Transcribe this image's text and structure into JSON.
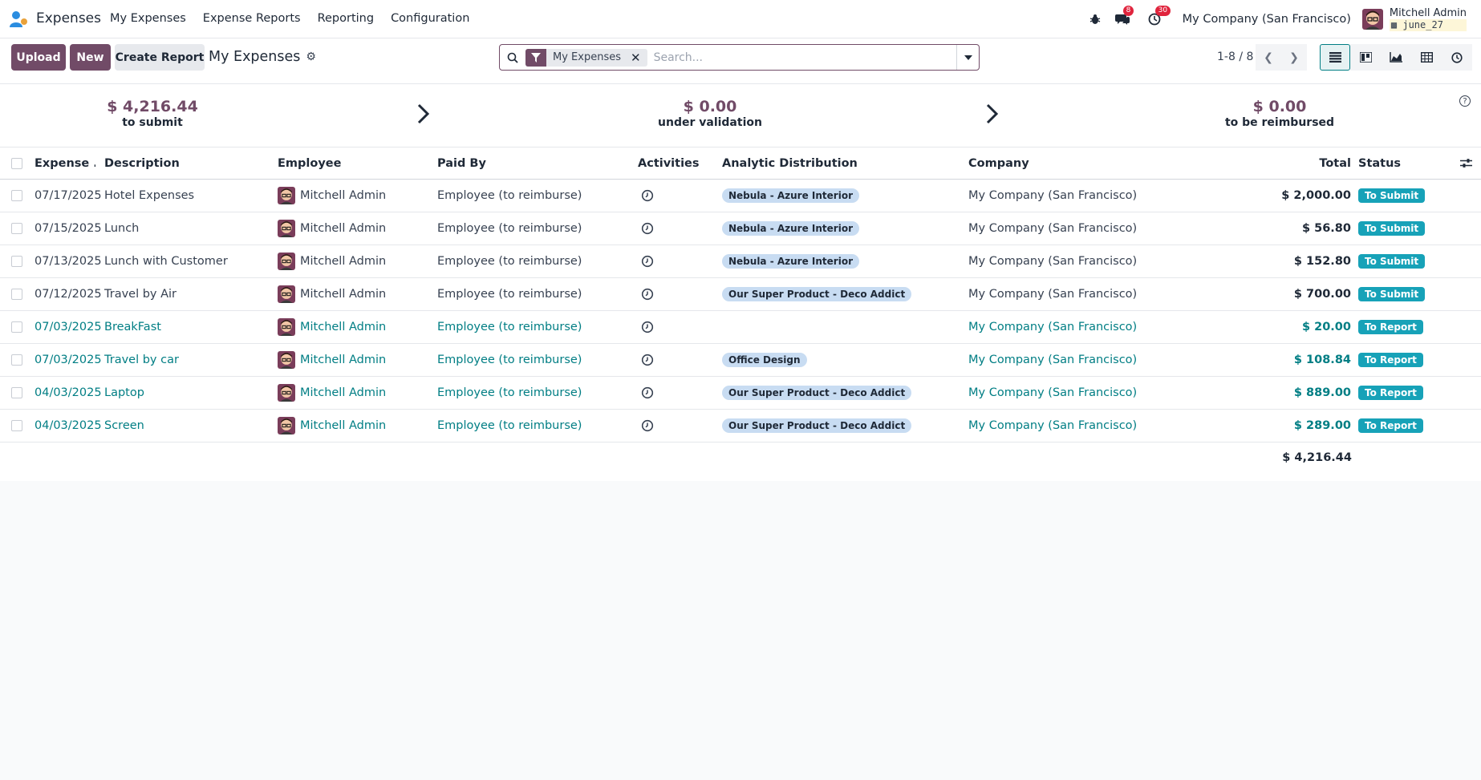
{
  "navbar": {
    "app_name": "Expenses",
    "menu": [
      "My Expenses",
      "Expense Reports",
      "Reporting",
      "Configuration"
    ],
    "messages_badge": "8",
    "activities_badge": "30",
    "company": "My Company (San Francisco)",
    "user_name": "Mitchell Admin",
    "database": "june_27"
  },
  "control": {
    "upload_label": "Upload",
    "new_label": "New",
    "create_report_label": "Create Report",
    "breadcrumb": "My Expenses",
    "facet_label": "My Expenses",
    "search_placeholder": "Search...",
    "pager": "1-8 / 8"
  },
  "dashboard": {
    "to_submit_amount": "$ 4,216.44",
    "to_submit_label": "to submit",
    "under_validation_amount": "$ 0.00",
    "under_validation_label": "under validation",
    "to_be_reimbursed_amount": "$ 0.00",
    "to_be_reimbursed_label": "to be reimbursed"
  },
  "table": {
    "columns": {
      "date": "Expense ...",
      "description": "Description",
      "employee": "Employee",
      "paid_by": "Paid By",
      "activities": "Activities",
      "analytic": "Analytic Distribution",
      "company": "Company",
      "total": "Total",
      "status": "Status"
    },
    "rows": [
      {
        "date": "07/17/2025",
        "description": "Hotel Expenses",
        "employee": "Mitchell Admin",
        "paid_by": "Employee (to reimburse)",
        "analytic": "Nebula - Azure Interior",
        "company": "My Company (San Francisco)",
        "total": "$ 2,000.00",
        "status": "To Submit"
      },
      {
        "date": "07/15/2025",
        "description": "Lunch",
        "employee": "Mitchell Admin",
        "paid_by": "Employee (to reimburse)",
        "analytic": "Nebula - Azure Interior",
        "company": "My Company (San Francisco)",
        "total": "$ 56.80",
        "status": "To Submit"
      },
      {
        "date": "07/13/2025",
        "description": "Lunch with Customer",
        "employee": "Mitchell Admin",
        "paid_by": "Employee (to reimburse)",
        "analytic": "Nebula - Azure Interior",
        "company": "My Company (San Francisco)",
        "total": "$ 152.80",
        "status": "To Submit"
      },
      {
        "date": "07/12/2025",
        "description": "Travel by Air",
        "employee": "Mitchell Admin",
        "paid_by": "Employee (to reimburse)",
        "analytic": "Our Super Product - Deco Addict",
        "company": "My Company (San Francisco)",
        "total": "$ 700.00",
        "status": "To Submit"
      },
      {
        "date": "07/03/2025",
        "description": "BreakFast",
        "employee": "Mitchell Admin",
        "paid_by": "Employee (to reimburse)",
        "analytic": "",
        "company": "My Company (San Francisco)",
        "total": "$ 20.00",
        "status": "To Report"
      },
      {
        "date": "07/03/2025",
        "description": "Travel by car",
        "employee": "Mitchell Admin",
        "paid_by": "Employee (to reimburse)",
        "analytic": "Office Design",
        "company": "My Company (San Francisco)",
        "total": "$ 108.84",
        "status": "To Report"
      },
      {
        "date": "04/03/2025",
        "description": "Laptop",
        "employee": "Mitchell Admin",
        "paid_by": "Employee (to reimburse)",
        "analytic": "Our Super Product - Deco Addict",
        "company": "My Company (San Francisco)",
        "total": "$ 889.00",
        "status": "To Report"
      },
      {
        "date": "04/03/2025",
        "description": "Screen",
        "employee": "Mitchell Admin",
        "paid_by": "Employee (to reimburse)",
        "analytic": "Our Super Product - Deco Addict",
        "company": "My Company (San Francisco)",
        "total": "$ 289.00",
        "status": "To Report"
      }
    ],
    "grand_total": "$ 4,216.44"
  },
  "colors": {
    "brand": "#714b67",
    "link": "#017e84",
    "status": "#17a2b8",
    "tag": "#c8dcf2"
  }
}
